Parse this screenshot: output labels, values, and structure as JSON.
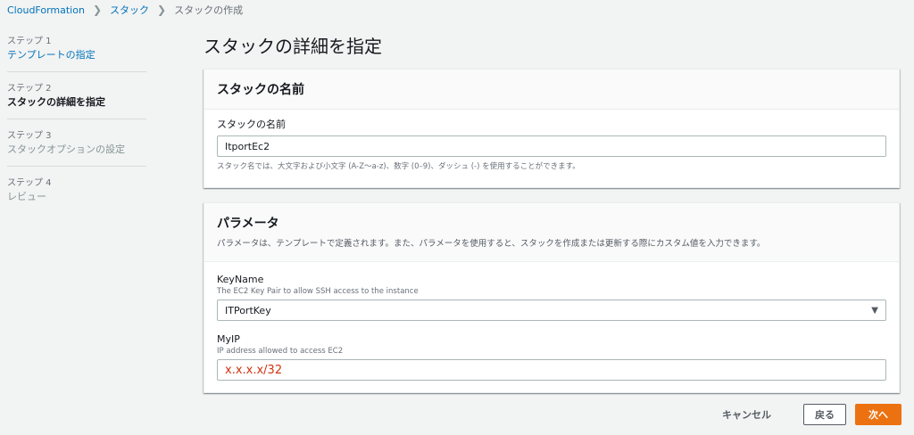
{
  "breadcrumb": {
    "items": [
      "CloudFormation",
      "スタック",
      "スタックの作成"
    ],
    "separator_icon": "chevron-right-icon"
  },
  "steps": [
    {
      "label": "ステップ 1",
      "title": "テンプレートの指定",
      "state": "link"
    },
    {
      "label": "ステップ 2",
      "title": "スタックの詳細を指定",
      "state": "active"
    },
    {
      "label": "ステップ 3",
      "title": "スタックオプションの設定",
      "state": "disabled"
    },
    {
      "label": "ステップ 4",
      "title": "レビュー",
      "state": "disabled"
    }
  ],
  "page_title": "スタックの詳細を指定",
  "stack_name_panel": {
    "title": "スタックの名前",
    "field_label": "スタックの名前",
    "value": "ItportEc2",
    "constraint": "スタック名では、大文字および小文字 (A-Z～a-z)、数字 (0–9)、ダッシュ (-) を使用することができます。"
  },
  "parameters_panel": {
    "title": "パラメータ",
    "description": "パラメータは、テンプレートで定義されます。また、パラメータを使用すると、スタックを作成または更新する際にカスタム値を入力できます。",
    "keyname": {
      "label": "KeyName",
      "description": "The EC2 Key Pair to allow SSH access to the instance",
      "value": "ITPortKey",
      "arrow_icon": "caret-down-icon"
    },
    "myip": {
      "label": "MyIP",
      "description": "IP address allowed to access EC2",
      "value": "x.x.x.x/32"
    }
  },
  "footer": {
    "cancel": "キャンセル",
    "back": "戻る",
    "next": "次へ"
  },
  "colors": {
    "link": "#0073bb",
    "primary_button": "#ec7211",
    "annotation_red": "#d13212"
  }
}
